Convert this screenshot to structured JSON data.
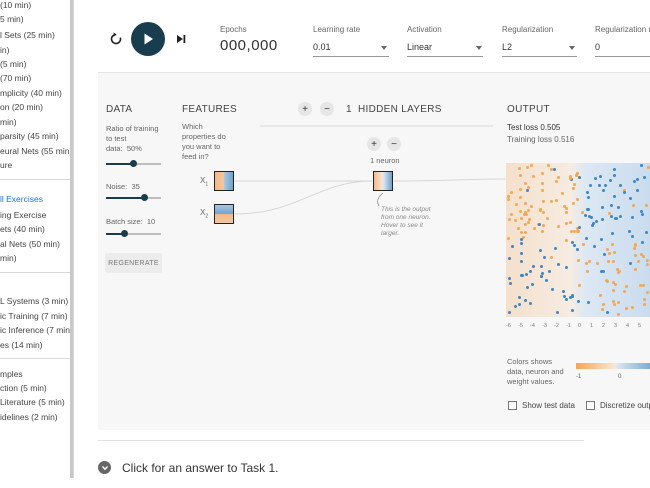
{
  "sidebar": {
    "items": [
      "(10 min)",
      "5 min)",
      "l Sets (25 min)",
      "in)",
      "(5 min)",
      "(70 min)",
      "mplicity (40 min)",
      "on (20 min)",
      "min)",
      "parsity (45 min)",
      "eural Nets (55 min)",
      "ure",
      "ll Exercises",
      "ing Exercise",
      "ets (40 min)",
      "al Nets (50 min)",
      "min)",
      "L Systems (3 min)",
      "ic Training (7 min)",
      "ic Inference (7 min)",
      "es (14 min)",
      "mples",
      "ction (5 min)",
      "Literature (5 min)",
      "idelines (2 min)"
    ]
  },
  "toolbar": {
    "epochs_label": "Epochs",
    "epochs_value": "000,000",
    "learning_rate_label": "Learning rate",
    "learning_rate_value": "0.01",
    "activation_label": "Activation",
    "activation_value": "Linear",
    "regularization_label": "Regularization",
    "regularization_value": "L2",
    "regularization_rate_label": "Regularization rate",
    "regularization_rate_value": "0"
  },
  "data_panel": {
    "title": "DATA",
    "ratio_label_line1": "Ratio of training",
    "ratio_label_line2": "to test",
    "ratio_label_line3": "data:",
    "ratio_value": "50%",
    "ratio_fraction": 0.5,
    "noise_label": "Noise:",
    "noise_value": "35",
    "noise_fraction": 0.7,
    "batch_label": "Batch size:",
    "batch_value": "10",
    "batch_fraction": 0.34,
    "regenerate_label": "REGENERATE"
  },
  "features_panel": {
    "title": "FEATURES",
    "question_line1": "Which",
    "question_line2": "properties do",
    "question_line3": "you want to",
    "question_line4": "feed in?",
    "feature_x1": "X",
    "feature_x1_sub": "1",
    "feature_x2": "X",
    "feature_x2_sub": "2"
  },
  "hidden_layers": {
    "count": "1",
    "label": "HIDDEN LAYERS",
    "neuron_count_label": "1 neuron",
    "tooltip_line1": "This is the output",
    "tooltip_line2": "from one neuron.",
    "tooltip_line3": "Hover to see it",
    "tooltip_line4": "larger."
  },
  "output_panel": {
    "title": "OUTPUT",
    "test_loss": "Test loss 0.505",
    "training_loss": "Training loss 0.516",
    "x_ticks": [
      "-6",
      "-5",
      "-4",
      "-3",
      "-2",
      "-1",
      "0",
      "1",
      "2",
      "3",
      "4",
      "5"
    ],
    "legend_line1": "Colors shows",
    "legend_line2": "data, neuron and",
    "legend_line3": "weight values.",
    "colorbar_min": "-1",
    "colorbar_mid": "0",
    "show_test_data_label": "Show test data",
    "discretize_label": "Discretize outp",
    "orange_color": "#f5a652",
    "blue_color": "#3d86c6"
  },
  "task": {
    "text": "Click for an answer to Task 1."
  }
}
